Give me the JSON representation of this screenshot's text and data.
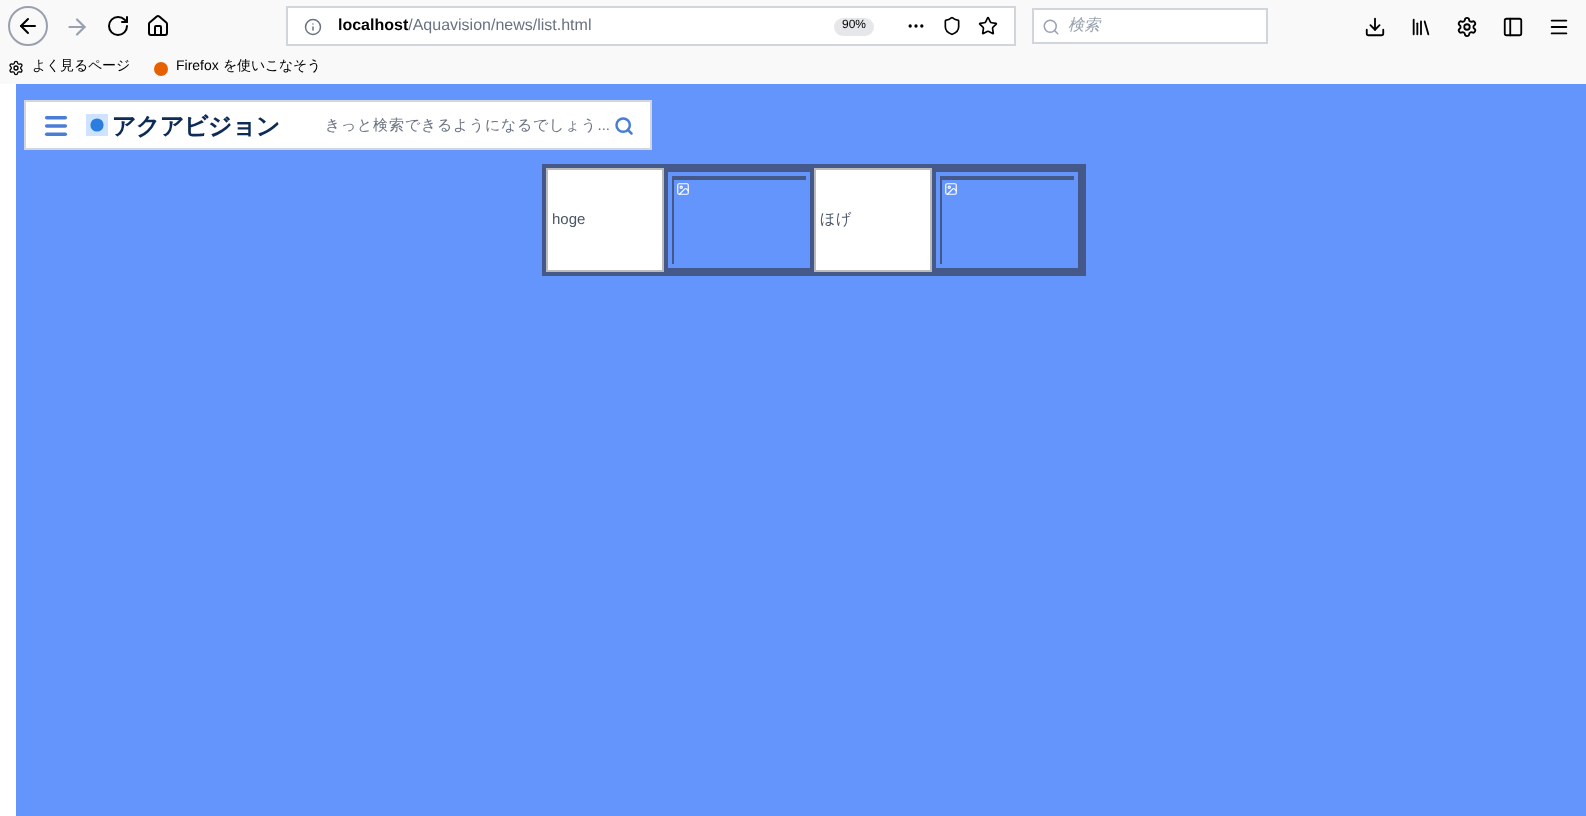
{
  "browser": {
    "url_host": "localhost",
    "url_path": "/Aquavision/news/list.html",
    "zoom": "90%",
    "search_placeholder": "検索",
    "bookmarks": [
      {
        "label": "よく見るページ",
        "kind": "gear"
      },
      {
        "label": "Firefox を使いこなそう",
        "kind": "firefox"
      }
    ]
  },
  "header": {
    "logo": "アクアビジョン",
    "search_placeholder": "きっと検索できるようになるでしょう..."
  },
  "news": [
    {
      "kind": "text",
      "text": "hoge"
    },
    {
      "kind": "image"
    },
    {
      "kind": "text",
      "text": "ほげ"
    },
    {
      "kind": "image"
    }
  ]
}
